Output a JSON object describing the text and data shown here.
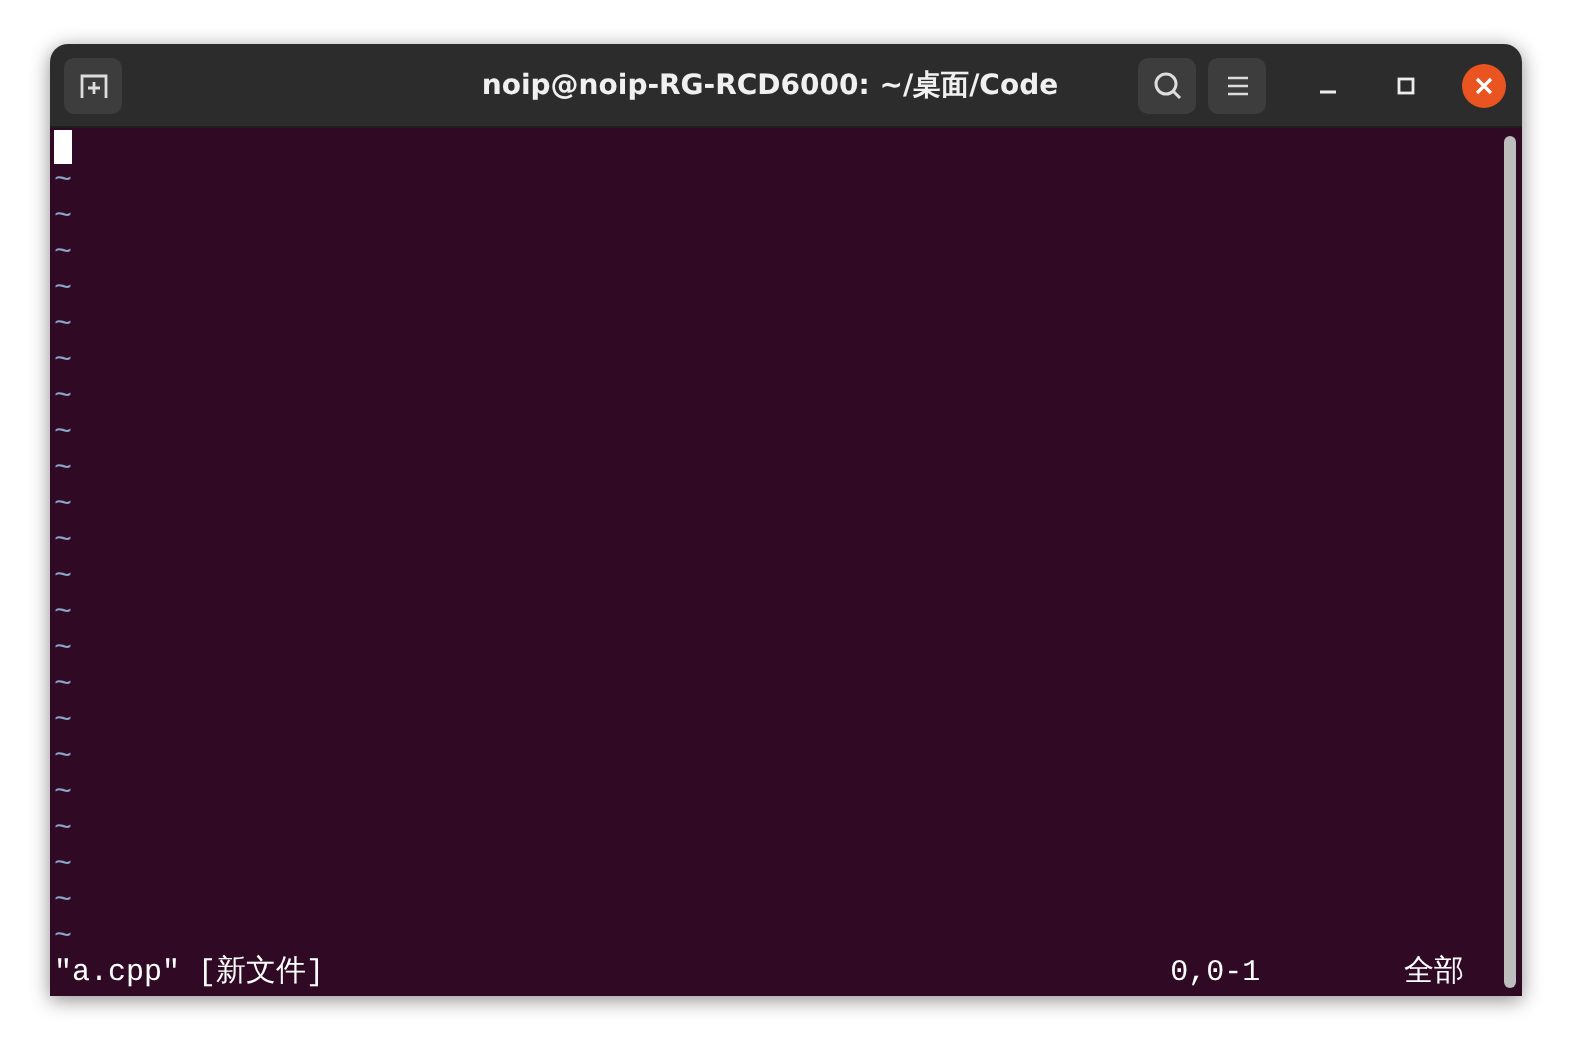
{
  "window": {
    "title": "noip@noip-RG-RCD6000: ~/桌面/Code"
  },
  "editor": {
    "empty_lines": [
      "~",
      "~",
      "~",
      "~",
      "~",
      "~",
      "~",
      "~",
      "~",
      "~",
      "~",
      "~",
      "~",
      "~",
      "~",
      "~",
      "~",
      "~",
      "~",
      "~",
      "~",
      "~"
    ]
  },
  "status_line": {
    "message": "\"a.cpp\" [新文件]",
    "cursor_position": "0,0-1",
    "scroll_position": "全部"
  }
}
